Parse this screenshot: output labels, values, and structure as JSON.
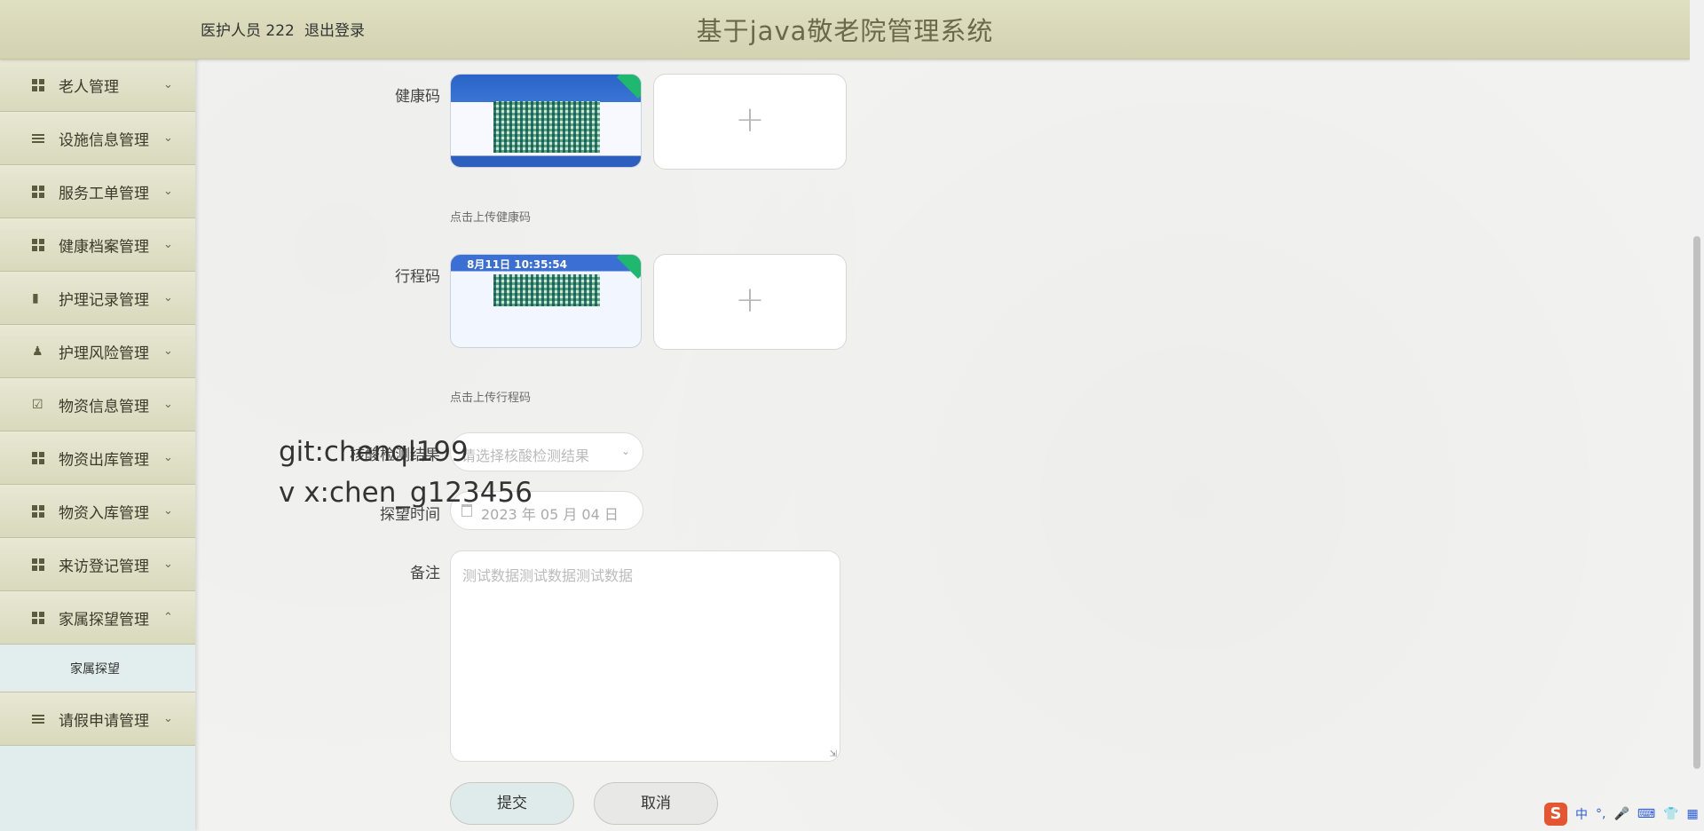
{
  "header": {
    "user": "医护人员 222",
    "logout": "退出登录",
    "title": "基于java敬老院管理系统"
  },
  "sidebar": {
    "items": [
      {
        "label": "老人管理",
        "icon": "grid-icon"
      },
      {
        "label": "设施信息管理",
        "icon": "list-icon"
      },
      {
        "label": "服务工单管理",
        "icon": "grid-icon"
      },
      {
        "label": "健康档案管理",
        "icon": "grid-icon"
      },
      {
        "label": "护理记录管理",
        "icon": "brush-icon"
      },
      {
        "label": "护理风险管理",
        "icon": "user-icon"
      },
      {
        "label": "物资信息管理",
        "icon": "clipboard-icon"
      },
      {
        "label": "物资出库管理",
        "icon": "grid-icon"
      },
      {
        "label": "物资入库管理",
        "icon": "grid-icon"
      },
      {
        "label": "来访登记管理",
        "icon": "grid-icon"
      },
      {
        "label": "家属探望管理",
        "icon": "grid-icon",
        "expanded": true
      },
      {
        "label": "请假申请管理",
        "icon": "list-icon"
      }
    ],
    "sub_item": "家属探望"
  },
  "form": {
    "health_code_label": "健康码",
    "health_code_hint": "点击上传健康码",
    "trip_code_label": "行程码",
    "trip_code_hint": "点击上传行程码",
    "trip_code_image_text": "8月11日 10:35:54",
    "nucleic_label": "核酸检测结果",
    "nucleic_placeholder": "请选择核酸检测结果",
    "visit_time_label": "探望时间",
    "visit_time_value": "2023 年 05 月 04 日",
    "remark_label": "备注",
    "remark_value": "测试数据测试数据测试数据",
    "submit": "提交",
    "cancel": "取消"
  },
  "watermark": {
    "line1": "git:chenql199",
    "line2": "v x:chen_g123456"
  },
  "tray": {
    "ime": "中",
    "punct": "°,"
  }
}
